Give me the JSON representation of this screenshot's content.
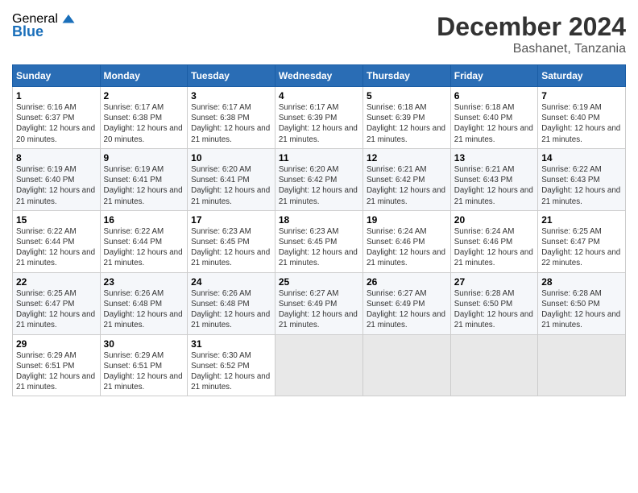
{
  "logo": {
    "general": "General",
    "blue": "Blue"
  },
  "header": {
    "title": "December 2024",
    "subtitle": "Bashanet, Tanzania"
  },
  "calendar": {
    "days_header": [
      "Sunday",
      "Monday",
      "Tuesday",
      "Wednesday",
      "Thursday",
      "Friday",
      "Saturday"
    ],
    "weeks": [
      [
        null,
        null,
        null,
        null,
        null,
        null,
        null
      ]
    ],
    "cells": [
      [
        {
          "day": null,
          "rise": "",
          "set": "",
          "daylight": ""
        },
        {
          "day": null,
          "rise": "",
          "set": "",
          "daylight": ""
        },
        {
          "day": null,
          "rise": "",
          "set": "",
          "daylight": ""
        },
        {
          "day": null,
          "rise": "",
          "set": "",
          "daylight": ""
        },
        {
          "day": null,
          "rise": "",
          "set": "",
          "daylight": ""
        },
        {
          "day": null,
          "rise": "",
          "set": "",
          "daylight": ""
        },
        {
          "day": null,
          "rise": "",
          "set": "",
          "daylight": ""
        }
      ]
    ],
    "rows": [
      {
        "cells": [
          {
            "day": "1",
            "sunrise": "Sunrise: 6:16 AM",
            "sunset": "Sunset: 6:37 PM",
            "daylight": "Daylight: 12 hours and 20 minutes."
          },
          {
            "day": "2",
            "sunrise": "Sunrise: 6:17 AM",
            "sunset": "Sunset: 6:38 PM",
            "daylight": "Daylight: 12 hours and 20 minutes."
          },
          {
            "day": "3",
            "sunrise": "Sunrise: 6:17 AM",
            "sunset": "Sunset: 6:38 PM",
            "daylight": "Daylight: 12 hours and 21 minutes."
          },
          {
            "day": "4",
            "sunrise": "Sunrise: 6:17 AM",
            "sunset": "Sunset: 6:39 PM",
            "daylight": "Daylight: 12 hours and 21 minutes."
          },
          {
            "day": "5",
            "sunrise": "Sunrise: 6:18 AM",
            "sunset": "Sunset: 6:39 PM",
            "daylight": "Daylight: 12 hours and 21 minutes."
          },
          {
            "day": "6",
            "sunrise": "Sunrise: 6:18 AM",
            "sunset": "Sunset: 6:40 PM",
            "daylight": "Daylight: 12 hours and 21 minutes."
          },
          {
            "day": "7",
            "sunrise": "Sunrise: 6:19 AM",
            "sunset": "Sunset: 6:40 PM",
            "daylight": "Daylight: 12 hours and 21 minutes."
          }
        ]
      },
      {
        "cells": [
          {
            "day": "8",
            "sunrise": "Sunrise: 6:19 AM",
            "sunset": "Sunset: 6:40 PM",
            "daylight": "Daylight: 12 hours and 21 minutes."
          },
          {
            "day": "9",
            "sunrise": "Sunrise: 6:19 AM",
            "sunset": "Sunset: 6:41 PM",
            "daylight": "Daylight: 12 hours and 21 minutes."
          },
          {
            "day": "10",
            "sunrise": "Sunrise: 6:20 AM",
            "sunset": "Sunset: 6:41 PM",
            "daylight": "Daylight: 12 hours and 21 minutes."
          },
          {
            "day": "11",
            "sunrise": "Sunrise: 6:20 AM",
            "sunset": "Sunset: 6:42 PM",
            "daylight": "Daylight: 12 hours and 21 minutes."
          },
          {
            "day": "12",
            "sunrise": "Sunrise: 6:21 AM",
            "sunset": "Sunset: 6:42 PM",
            "daylight": "Daylight: 12 hours and 21 minutes."
          },
          {
            "day": "13",
            "sunrise": "Sunrise: 6:21 AM",
            "sunset": "Sunset: 6:43 PM",
            "daylight": "Daylight: 12 hours and 21 minutes."
          },
          {
            "day": "14",
            "sunrise": "Sunrise: 6:22 AM",
            "sunset": "Sunset: 6:43 PM",
            "daylight": "Daylight: 12 hours and 21 minutes."
          }
        ]
      },
      {
        "cells": [
          {
            "day": "15",
            "sunrise": "Sunrise: 6:22 AM",
            "sunset": "Sunset: 6:44 PM",
            "daylight": "Daylight: 12 hours and 21 minutes."
          },
          {
            "day": "16",
            "sunrise": "Sunrise: 6:22 AM",
            "sunset": "Sunset: 6:44 PM",
            "daylight": "Daylight: 12 hours and 21 minutes."
          },
          {
            "day": "17",
            "sunrise": "Sunrise: 6:23 AM",
            "sunset": "Sunset: 6:45 PM",
            "daylight": "Daylight: 12 hours and 21 minutes."
          },
          {
            "day": "18",
            "sunrise": "Sunrise: 6:23 AM",
            "sunset": "Sunset: 6:45 PM",
            "daylight": "Daylight: 12 hours and 21 minutes."
          },
          {
            "day": "19",
            "sunrise": "Sunrise: 6:24 AM",
            "sunset": "Sunset: 6:46 PM",
            "daylight": "Daylight: 12 hours and 21 minutes."
          },
          {
            "day": "20",
            "sunrise": "Sunrise: 6:24 AM",
            "sunset": "Sunset: 6:46 PM",
            "daylight": "Daylight: 12 hours and 21 minutes."
          },
          {
            "day": "21",
            "sunrise": "Sunrise: 6:25 AM",
            "sunset": "Sunset: 6:47 PM",
            "daylight": "Daylight: 12 hours and 22 minutes."
          }
        ]
      },
      {
        "cells": [
          {
            "day": "22",
            "sunrise": "Sunrise: 6:25 AM",
            "sunset": "Sunset: 6:47 PM",
            "daylight": "Daylight: 12 hours and 21 minutes."
          },
          {
            "day": "23",
            "sunrise": "Sunrise: 6:26 AM",
            "sunset": "Sunset: 6:48 PM",
            "daylight": "Daylight: 12 hours and 21 minutes."
          },
          {
            "day": "24",
            "sunrise": "Sunrise: 6:26 AM",
            "sunset": "Sunset: 6:48 PM",
            "daylight": "Daylight: 12 hours and 21 minutes."
          },
          {
            "day": "25",
            "sunrise": "Sunrise: 6:27 AM",
            "sunset": "Sunset: 6:49 PM",
            "daylight": "Daylight: 12 hours and 21 minutes."
          },
          {
            "day": "26",
            "sunrise": "Sunrise: 6:27 AM",
            "sunset": "Sunset: 6:49 PM",
            "daylight": "Daylight: 12 hours and 21 minutes."
          },
          {
            "day": "27",
            "sunrise": "Sunrise: 6:28 AM",
            "sunset": "Sunset: 6:50 PM",
            "daylight": "Daylight: 12 hours and 21 minutes."
          },
          {
            "day": "28",
            "sunrise": "Sunrise: 6:28 AM",
            "sunset": "Sunset: 6:50 PM",
            "daylight": "Daylight: 12 hours and 21 minutes."
          }
        ]
      },
      {
        "cells": [
          {
            "day": "29",
            "sunrise": "Sunrise: 6:29 AM",
            "sunset": "Sunset: 6:51 PM",
            "daylight": "Daylight: 12 hours and 21 minutes."
          },
          {
            "day": "30",
            "sunrise": "Sunrise: 6:29 AM",
            "sunset": "Sunset: 6:51 PM",
            "daylight": "Daylight: 12 hours and 21 minutes."
          },
          {
            "day": "31",
            "sunrise": "Sunrise: 6:30 AM",
            "sunset": "Sunset: 6:52 PM",
            "daylight": "Daylight: 12 hours and 21 minutes."
          },
          null,
          null,
          null,
          null
        ]
      }
    ]
  }
}
